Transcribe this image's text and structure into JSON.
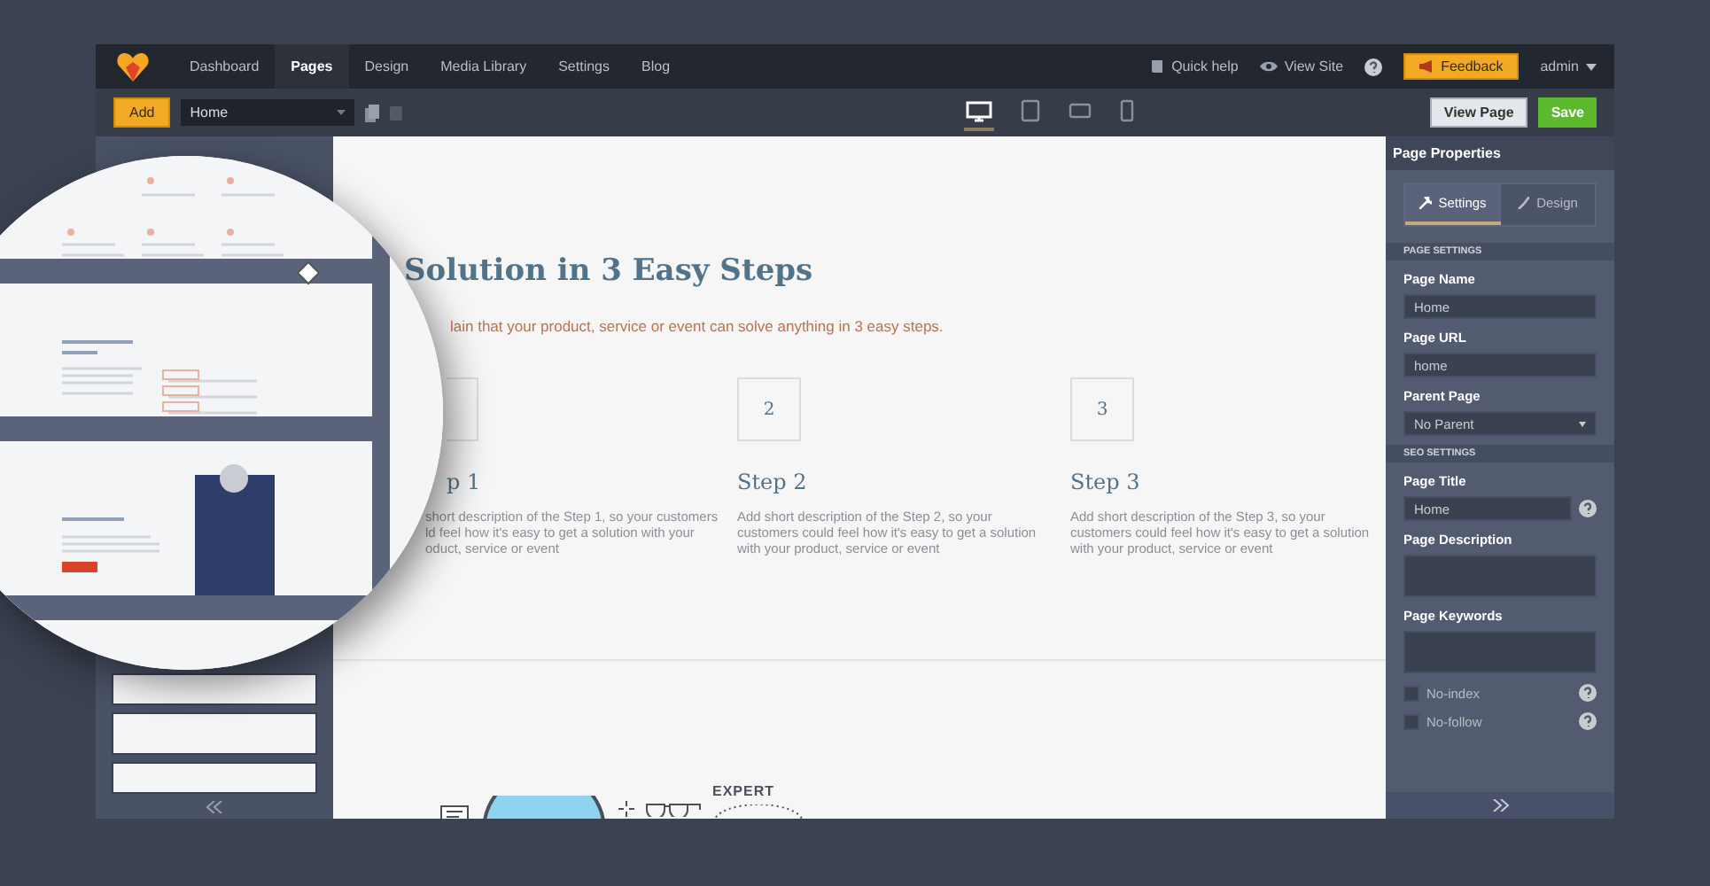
{
  "nav": {
    "items": [
      {
        "label": "Dashboard",
        "selected": false
      },
      {
        "label": "Pages",
        "selected": true
      },
      {
        "label": "Design",
        "selected": false
      },
      {
        "label": "Media Library",
        "selected": false
      },
      {
        "label": "Settings",
        "selected": false
      },
      {
        "label": "Blog",
        "selected": false
      }
    ],
    "quick_help": "Quick help",
    "view_site": "View Site",
    "feedback": "Feedback",
    "user": "admin"
  },
  "toolbar": {
    "add": "Add",
    "page_select": "Home",
    "devices": [
      {
        "kind": "desktop",
        "selected": true
      },
      {
        "kind": "tablet",
        "selected": false
      },
      {
        "kind": "tablet-landscape",
        "selected": false
      },
      {
        "kind": "phone",
        "selected": false
      }
    ],
    "view_page": "View Page",
    "save": "Save"
  },
  "canvas": {
    "title": "Solution in 3 Easy Steps",
    "subtitle": "lain that your product, service or event can solve anything in 3 easy steps.",
    "steps": [
      {
        "title": "p 1",
        "description": "short description of the Step 1, so your customers\nld feel how it's easy to get a solution with your\noduct, service or event"
      },
      {
        "number": "2",
        "title": "Step 2",
        "description": "Add short description of the Step 2, so your customers could feel how it's easy to get a solution with your product, service or event"
      },
      {
        "number": "3",
        "title": "Step 3",
        "description": "Add short description of the Step 3, so your customers could feel how it's easy to get a solution with your product, service or event"
      }
    ],
    "illustration_label": "EXPERT"
  },
  "panel": {
    "title": "Page Properties",
    "tabs": [
      {
        "label": "Settings",
        "selected": true
      },
      {
        "label": "Design",
        "selected": false
      }
    ],
    "sections": [
      {
        "heading": "PAGE SETTINGS",
        "fields": [
          {
            "kind": "text",
            "label": "Page Name",
            "value": "Home",
            "help": false
          },
          {
            "kind": "text",
            "label": "Page URL",
            "value": "home",
            "help": false
          },
          {
            "kind": "select",
            "label": "Parent Page",
            "value": "No Parent",
            "help": false
          }
        ]
      },
      {
        "heading": "SEO SETTINGS",
        "fields": [
          {
            "kind": "text",
            "label": "Page Title",
            "value": "Home",
            "help": true
          },
          {
            "kind": "textarea",
            "label": "Page Description",
            "help": false
          },
          {
            "kind": "textarea",
            "label": "Page Keywords",
            "help": false
          },
          {
            "kind": "checkbox",
            "label": "No-index",
            "checked": false,
            "help": true
          },
          {
            "kind": "checkbox",
            "label": "No-follow",
            "checked": false,
            "help": true
          }
        ]
      }
    ]
  }
}
